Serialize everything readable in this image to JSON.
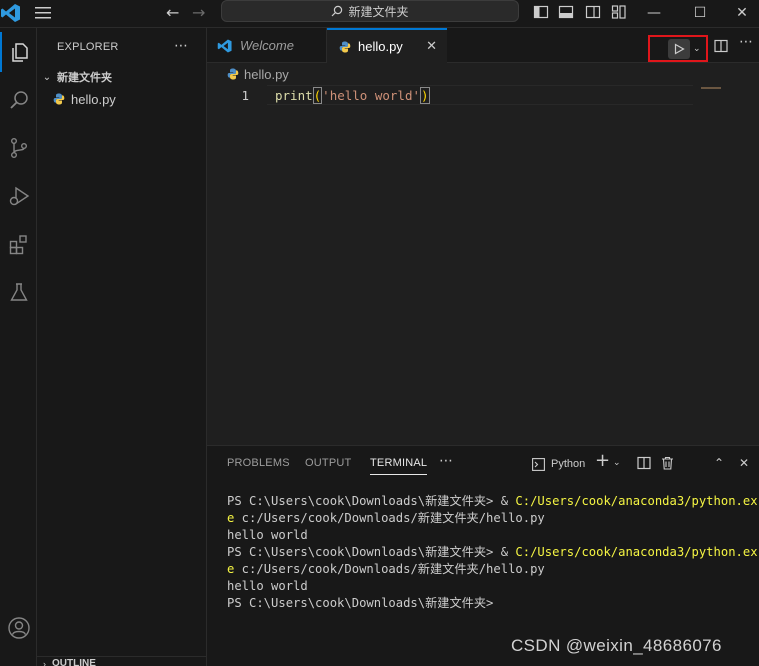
{
  "window": {
    "search_text": "新建文件夹"
  },
  "sidebar": {
    "title": "EXPLORER",
    "folder_name": "新建文件夹",
    "files": [
      "hello.py"
    ],
    "outline_label": "OUTLINE"
  },
  "editor": {
    "tabs": [
      {
        "label": "Welcome",
        "icon": "vscode-icon"
      },
      {
        "label": "hello.py",
        "icon": "python-icon",
        "active": true
      }
    ],
    "breadcrumb": "hello.py",
    "lines": [
      {
        "number": "1",
        "fn": "print",
        "open": "(",
        "string": "'hello world'",
        "close": ")"
      }
    ]
  },
  "panel": {
    "tabs": [
      "PROBLEMS",
      "OUTPUT",
      "TERMINAL"
    ],
    "active_tab": "TERMINAL",
    "terminal_profile": "Python",
    "terminal": {
      "prompt1": "PS C:\\Users\\cook\\Downloads\\新建文件夹> & ",
      "exe1a": "C:/Users/cook/anaconda3/python.ex",
      "exe1b": "e",
      "arg1": " c:/Users/cook/Downloads/新建文件夹/hello.py",
      "out1": "hello world",
      "prompt2": "PS C:\\Users\\cook\\Downloads\\新建文件夹> & ",
      "exe2a": "C:/Users/cook/anaconda3/python.ex",
      "exe2b": "e",
      "arg2": " c:/Users/cook/Downloads/新建文件夹/hello.py",
      "out2": "hello world",
      "prompt3": "PS C:\\Users\\cook\\Downloads\\新建文件夹>"
    }
  },
  "watermark": "CSDN @weixin_48686076",
  "colors": {
    "accent": "#0078d4",
    "highlight_box": "#e0161b",
    "terminal_exe": "#f5f543"
  }
}
